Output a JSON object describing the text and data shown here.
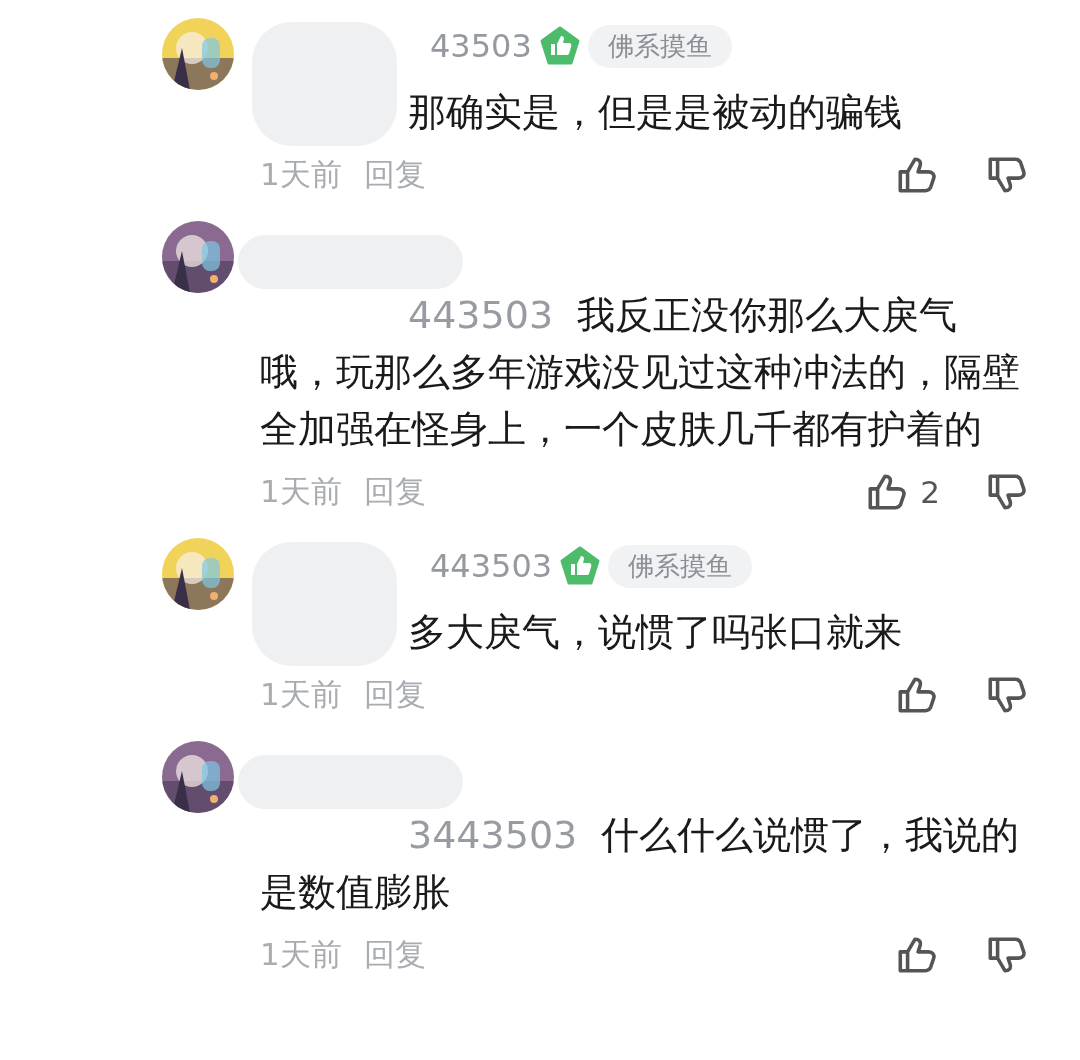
{
  "comments": [
    {
      "username": "43503",
      "verified": true,
      "badge": "佛系摸鱼",
      "text": "那确实是，但是是被动的骗钱",
      "time": "1天前",
      "reply": "回复"
    },
    {
      "mention": "443503",
      "text": "我反正没你那么大戾气哦，玩那么多年游戏没见过这种冲法的，隔壁全加强在怪身上，一个皮肤几千都有护着的",
      "time": "1天前",
      "reply": "回复",
      "likes": "2"
    },
    {
      "username": "443503",
      "verified": true,
      "badge": "佛系摸鱼",
      "text": "多大戾气，说惯了吗张口就来",
      "time": "1天前",
      "reply": "回复"
    },
    {
      "mention": "3443503",
      "text": "什么什么说惯了，我说的是数值膨胀",
      "time": "1天前",
      "reply": "回复"
    }
  ]
}
